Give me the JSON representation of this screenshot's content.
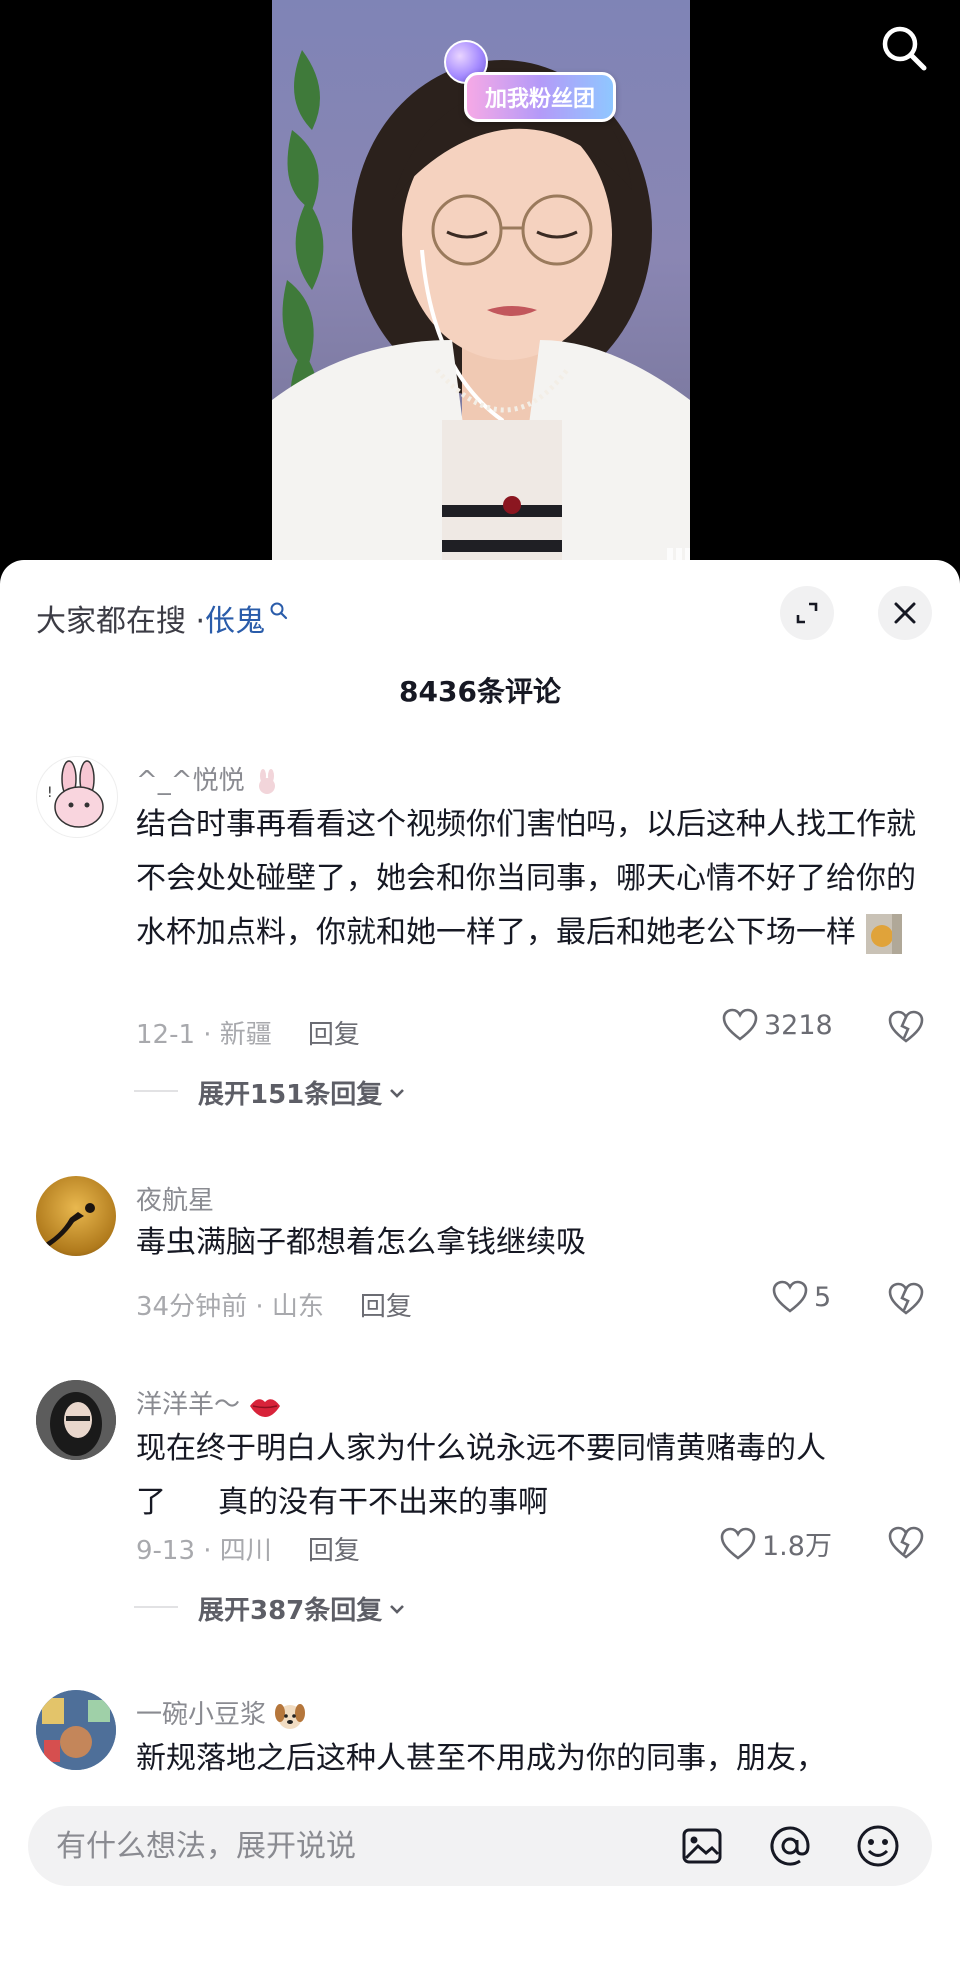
{
  "video": {
    "fan_badge_label": "加我粉丝团"
  },
  "panel": {
    "search_prefix": "大家都在搜 · ",
    "search_keyword": "伥鬼",
    "comment_count": "8436条评论"
  },
  "comments": [
    {
      "user": "^_^悦悦",
      "text": "结合时事再看看这个视频你们害怕吗，以后这种人找工作就不会处处碰壁了，她会和你当同事，哪天心情不好了给你的水杯加点料，你就和她一样了，最后和她老公下场一样",
      "date_location": "12-1 · 新疆",
      "reply_label": "回复",
      "likes": "3218",
      "expand_label": "展开151条回复"
    },
    {
      "user": "夜航星",
      "text": "毒虫满脑子都想着怎么拿钱继续吸",
      "date_location": "34分钟前 · 山东",
      "reply_label": "回复",
      "likes": "5"
    },
    {
      "user": "洋洋羊～",
      "text_line1": "现在终于明白人家为什么说永远不要同情黄赌毒的人",
      "text_line2_a": "了",
      "text_line2_b": "真的没有干不出来的事啊",
      "date_location": "9-13 · 四川",
      "reply_label": "回复",
      "likes": "1.8万",
      "expand_label": "展开387条回复"
    },
    {
      "user": "一碗小豆浆",
      "text": "新规落地之后这种人甚至不用成为你的同事，朋友，"
    }
  ],
  "input": {
    "placeholder": "有什么想法，展开说说"
  },
  "colors": {
    "keyword_link": "#2a5caa",
    "panel_bg": "#ffffff",
    "input_bg": "#f2f2f3"
  }
}
